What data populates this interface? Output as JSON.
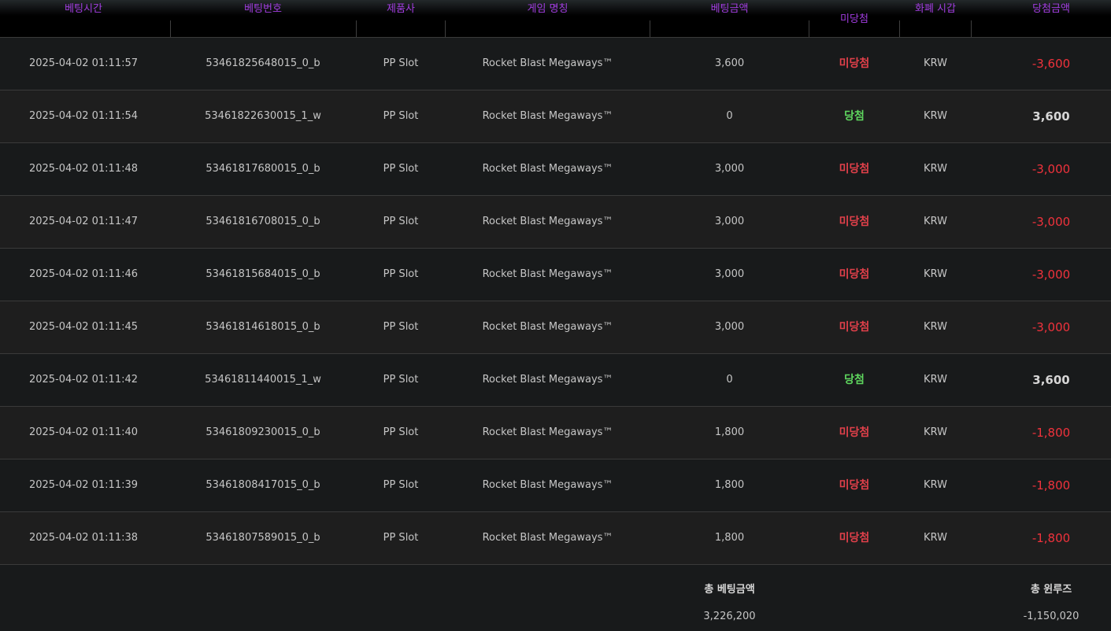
{
  "table": {
    "headers": {
      "bet_time": "베팅시간",
      "bet_no": "베팅번호",
      "provider": "제품사",
      "game_name": "게임 명칭",
      "bet_amount": "베팅금액",
      "result": "미당첨",
      "currency": "화폐 시갑",
      "win_amount": "당첨금액"
    },
    "rows": [
      {
        "time": "2025-04-02 01:11:57",
        "id": "53461825648015_0_b",
        "provider": "PP Slot",
        "game": "Rocket Blast Megaways™",
        "bet": "3,600",
        "result": "미당첨",
        "currency": "KRW",
        "win": "-3,600"
      },
      {
        "time": "2025-04-02 01:11:54",
        "id": "53461822630015_1_w",
        "provider": "PP Slot",
        "game": "Rocket Blast Megaways™",
        "bet": "0",
        "result": "당첨",
        "currency": "KRW",
        "win": "3,600"
      },
      {
        "time": "2025-04-02 01:11:48",
        "id": "53461817680015_0_b",
        "provider": "PP Slot",
        "game": "Rocket Blast Megaways™",
        "bet": "3,000",
        "result": "미당첨",
        "currency": "KRW",
        "win": "-3,000"
      },
      {
        "time": "2025-04-02 01:11:47",
        "id": "53461816708015_0_b",
        "provider": "PP Slot",
        "game": "Rocket Blast Megaways™",
        "bet": "3,000",
        "result": "미당첨",
        "currency": "KRW",
        "win": "-3,000"
      },
      {
        "time": "2025-04-02 01:11:46",
        "id": "53461815684015_0_b",
        "provider": "PP Slot",
        "game": "Rocket Blast Megaways™",
        "bet": "3,000",
        "result": "미당첨",
        "currency": "KRW",
        "win": "-3,000"
      },
      {
        "time": "2025-04-02 01:11:45",
        "id": "53461814618015_0_b",
        "provider": "PP Slot",
        "game": "Rocket Blast Megaways™",
        "bet": "3,000",
        "result": "미당첨",
        "currency": "KRW",
        "win": "-3,000"
      },
      {
        "time": "2025-04-02 01:11:42",
        "id": "53461811440015_1_w",
        "provider": "PP Slot",
        "game": "Rocket Blast Megaways™",
        "bet": "0",
        "result": "당첨",
        "currency": "KRW",
        "win": "3,600"
      },
      {
        "time": "2025-04-02 01:11:40",
        "id": "53461809230015_0_b",
        "provider": "PP Slot",
        "game": "Rocket Blast Megaways™",
        "bet": "1,800",
        "result": "미당첨",
        "currency": "KRW",
        "win": "-1,800"
      },
      {
        "time": "2025-04-02 01:11:39",
        "id": "53461808417015_0_b",
        "provider": "PP Slot",
        "game": "Rocket Blast Megaways™",
        "bet": "1,800",
        "result": "미당첨",
        "currency": "KRW",
        "win": "-1,800"
      },
      {
        "time": "2025-04-02 01:11:38",
        "id": "53461807589015_0_b",
        "provider": "PP Slot",
        "game": "Rocket Blast Megaways™",
        "bet": "1,800",
        "result": "미당첨",
        "currency": "KRW",
        "win": "-1,800"
      }
    ]
  },
  "summary": {
    "total_bet_label": "총 베팅금액",
    "total_bet_value": "3,226,200",
    "total_winloss_label": "총 윈루즈",
    "total_winloss_value": "-1,150,020"
  },
  "colors": {
    "header_text": "#a23de0",
    "lose_text": "#e0404a",
    "win_text": "#5ed65e",
    "negative_amount": "#f0323c"
  }
}
